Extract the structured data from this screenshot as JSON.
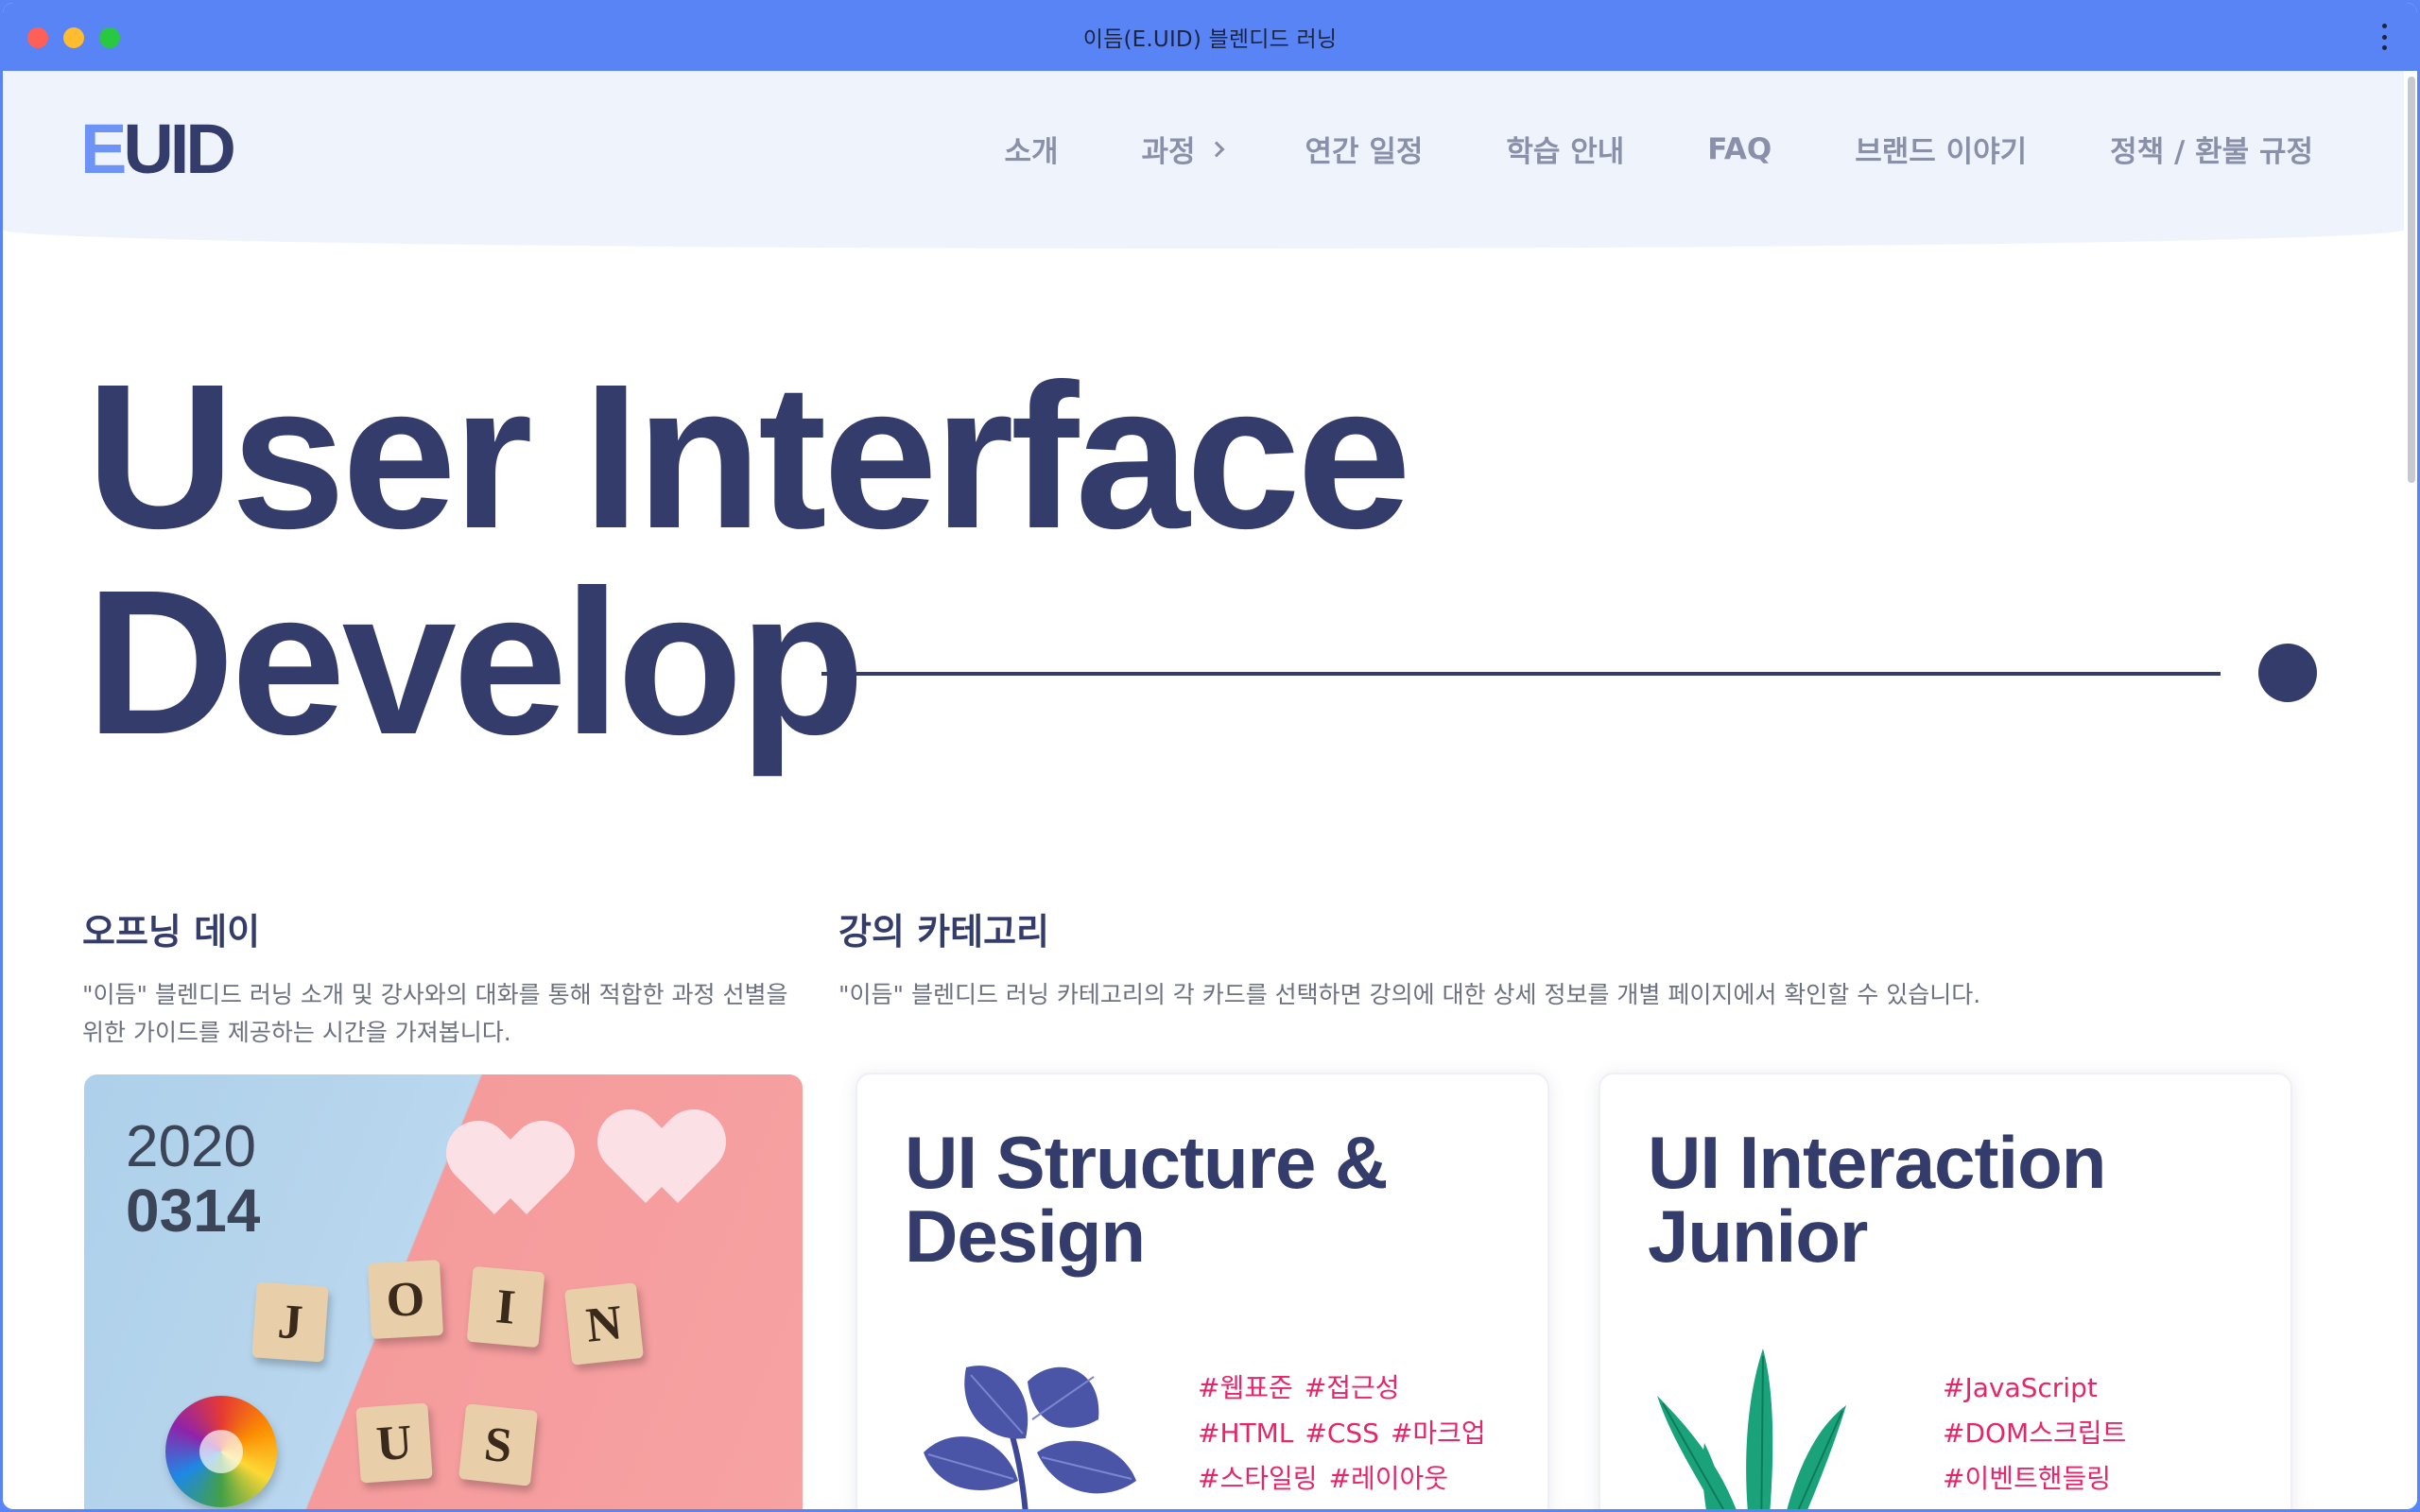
{
  "window": {
    "title": "이듬(E.UID) 블렌디드 러닝"
  },
  "logo": {
    "e": "E",
    "rest": "UID"
  },
  "nav": [
    {
      "label": "소개"
    },
    {
      "label": "과정"
    },
    {
      "label": "연간 일정"
    },
    {
      "label": "학습 안내"
    },
    {
      "label": "FAQ"
    },
    {
      "label": "브랜드 이야기"
    },
    {
      "label": "정책 / 환불 규정"
    }
  ],
  "hero": {
    "line1": "User Interface",
    "line2": "Develop"
  },
  "opening": {
    "title": "오프닝 데이",
    "description": "\"이듬\" 블렌디드 러닝 소개 및 강사와의 대화를 통해 적합한 과정 선별을 위한 가이드를 제공하는 시간을 가져봅니다.",
    "year": "2020",
    "date": "0314",
    "tiles": [
      "J",
      "O",
      "I",
      "N",
      "U",
      "S"
    ]
  },
  "category": {
    "title": "강의 카테고리",
    "description": "\"이듬\" 블렌디드 러닝 카테고리의 각 카드를 선택하면 강의에 대한 상세 정보를 개별 페이지에서 확인할 수 있습니다.",
    "cards": [
      {
        "title": "UI Structure & Design",
        "tags": [
          [
            "#웹표준",
            "#접근성"
          ],
          [
            "#HTML",
            "#CSS",
            "#마크업"
          ],
          [
            "#스타일링",
            "#레이아웃"
          ]
        ]
      },
      {
        "title": "UI Interaction Junior",
        "tags": [
          [
            "#JavaScript"
          ],
          [
            "#DOM스크립트"
          ],
          [
            "#이벤트핸들링"
          ]
        ]
      }
    ]
  },
  "colors": {
    "accent": "#5884f6",
    "navy": "#343c6b",
    "tag": "#e6266a",
    "header_bg": "#eff3fc"
  }
}
